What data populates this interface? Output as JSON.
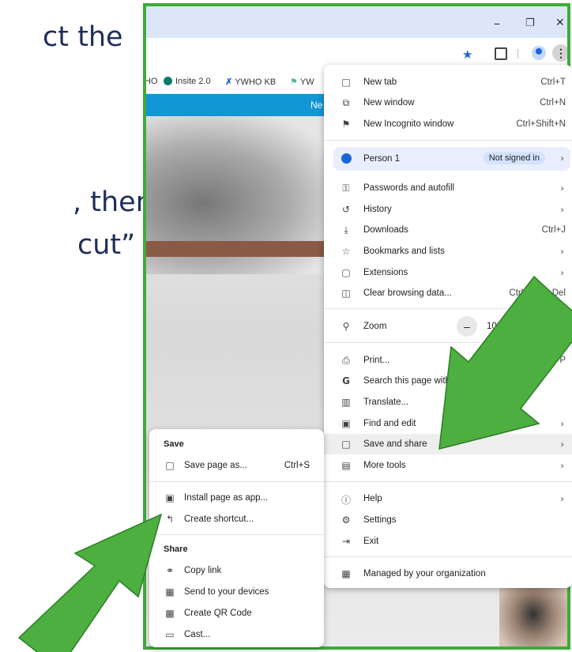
{
  "slide": {
    "line1": "ct the",
    "line2": ", then",
    "line3": "cut”"
  },
  "window": {
    "minimize": "–",
    "restore": "❐",
    "close": "✕"
  },
  "bookmarks": [
    "HO",
    "Insite 2.0",
    "YWHO KB",
    "YW"
  ],
  "bluebar_text": "Ne",
  "menu": {
    "new_tab": {
      "label": "New tab",
      "shortcut": "Ctrl+T"
    },
    "new_window": {
      "label": "New window",
      "shortcut": "Ctrl+N"
    },
    "new_incognito": {
      "label": "New Incognito window",
      "shortcut": "Ctrl+Shift+N"
    },
    "person": {
      "label": "Person 1",
      "badge": "Not signed in"
    },
    "passwords": {
      "label": "Passwords and autofill"
    },
    "history": {
      "label": "History"
    },
    "downloads": {
      "label": "Downloads",
      "shortcut": "Ctrl+J"
    },
    "bookmarks": {
      "label": "Bookmarks and lists"
    },
    "extensions": {
      "label": "Extensions"
    },
    "clear_data": {
      "label": "Clear browsing data...",
      "shortcut": "Ctrl+Shift+Del"
    },
    "zoom": {
      "label": "Zoom",
      "value": "100%"
    },
    "print": {
      "label": "Print...",
      "shortcut": "Ctrl+P"
    },
    "search_page": {
      "label": "Search this page with Go"
    },
    "translate": {
      "label": "Translate..."
    },
    "find_edit": {
      "label": "Find and edit"
    },
    "save_share": {
      "label": "Save and share"
    },
    "more_tools": {
      "label": "More tools"
    },
    "help": {
      "label": "Help"
    },
    "settings": {
      "label": "Settings"
    },
    "exit": {
      "label": "Exit"
    },
    "managed": {
      "label": "Managed by your organization"
    }
  },
  "submenu": {
    "save_heading": "Save",
    "save_page": {
      "label": "Save page as...",
      "shortcut": "Ctrl+S"
    },
    "install_app": {
      "label": "Install page as app..."
    },
    "create_shortcut": {
      "label": "Create shortcut..."
    },
    "share_heading": "Share",
    "copy_link": {
      "label": "Copy link"
    },
    "send_devices": {
      "label": "Send to your devices"
    },
    "qr_code": {
      "label": "Create QR Code"
    },
    "cast": {
      "label": "Cast..."
    }
  },
  "colors": {
    "frame_border": "#3fab3a",
    "arrow_fill": "#4caf3f",
    "slide_text": "#1f2d5a",
    "accent_blue": "#1a66d9"
  },
  "icons": {
    "chevron": "›",
    "star": "★"
  }
}
